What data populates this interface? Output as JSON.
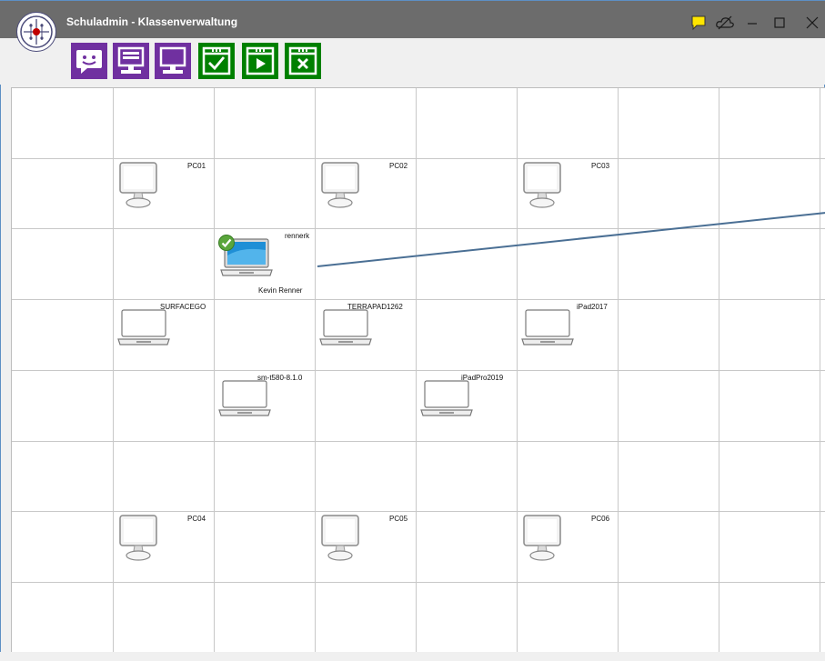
{
  "window": {
    "title": "Schuladmin - Klassenverwaltung"
  },
  "title_bar_controls": [
    "chat-bubble",
    "cloud",
    "minimize",
    "maximize",
    "close"
  ],
  "toolbar": {
    "buttons": [
      {
        "icon": "chat-smiley-icon",
        "color": "#7030a0"
      },
      {
        "icon": "monitor-icon",
        "color": "#7030a0"
      },
      {
        "icon": "monitor-screen-icon",
        "color": "#7030a0"
      },
      {
        "icon": "window-check-icon",
        "color": "#008000"
      },
      {
        "icon": "window-play-icon",
        "color": "#008000"
      },
      {
        "icon": "window-close-icon",
        "color": "#008000"
      }
    ]
  },
  "devices": {
    "pc01": {
      "label": "PC01"
    },
    "pc02": {
      "label": "PC02"
    },
    "pc03": {
      "label": "PC03"
    },
    "rennerk": {
      "label": "rennerk",
      "user": "Kevin Renner",
      "status": "online"
    },
    "surfacego": {
      "label": "SURFACEGO"
    },
    "terrapad": {
      "label": "TERRAPAD1262"
    },
    "ipad2017": {
      "label": "iPad2017"
    },
    "smt580": {
      "label": "sm-t580-8.1.0"
    },
    "ipadpro": {
      "label": "iPadPro2019"
    },
    "pc04": {
      "label": "PC04"
    },
    "pc05": {
      "label": "PC05"
    },
    "pc06": {
      "label": "PC06"
    }
  },
  "colors": {
    "titlebar": "#6c6c6c",
    "purple_button": "#7030a0",
    "green_button": "#008000",
    "link_line": "#4a6f94",
    "notification": "#ffe600"
  }
}
